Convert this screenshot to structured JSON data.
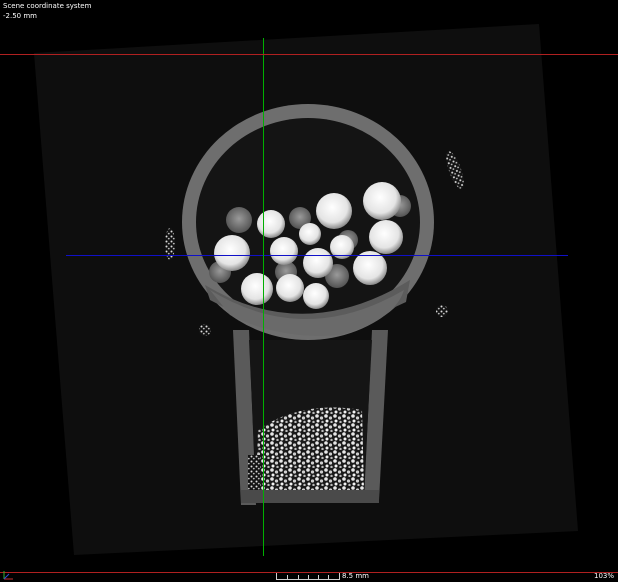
{
  "hud": {
    "coordinate_system": "Scene coordinate system",
    "slice_position": "-2.50 mm"
  },
  "status": {
    "scale_value": "8.5 mm",
    "zoom_level": "103%"
  },
  "icons": {
    "axis": "axis-triad-icon"
  },
  "colors": {
    "background": "#000000",
    "horizontal_crosshair": "#1010c8",
    "vertical_crosshair": "#00b000",
    "frame_lines": "#b02020"
  }
}
